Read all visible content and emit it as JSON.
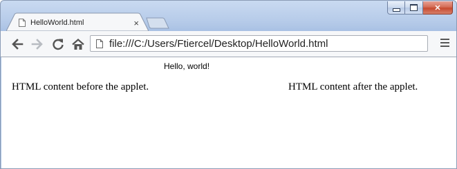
{
  "browser": {
    "tab": {
      "title": "HelloWorld.html",
      "close_glyph": "×"
    },
    "window_controls": {
      "minimize_icon": "minimize-icon",
      "maximize_icon": "maximize-icon",
      "close_glyph": "✕"
    },
    "toolbar": {
      "back_icon": "back-arrow-icon",
      "forward_icon": "forward-arrow-icon",
      "reload_icon": "reload-icon",
      "home_icon": "home-icon",
      "menu_icon": "hamburger-menu-icon"
    },
    "omnibox": {
      "url": "file:///C:/Users/Ftiercel/Desktop/HelloWorld.html",
      "page_icon": "page-icon"
    }
  },
  "page": {
    "applet_text": "Hello, world!",
    "before_text": "HTML content before the applet.",
    "after_text": "HTML content after the applet."
  },
  "colors": {
    "frame": "#b6cbe9",
    "close_button": "#c74a30",
    "toolbar": "#f6f7f9"
  }
}
